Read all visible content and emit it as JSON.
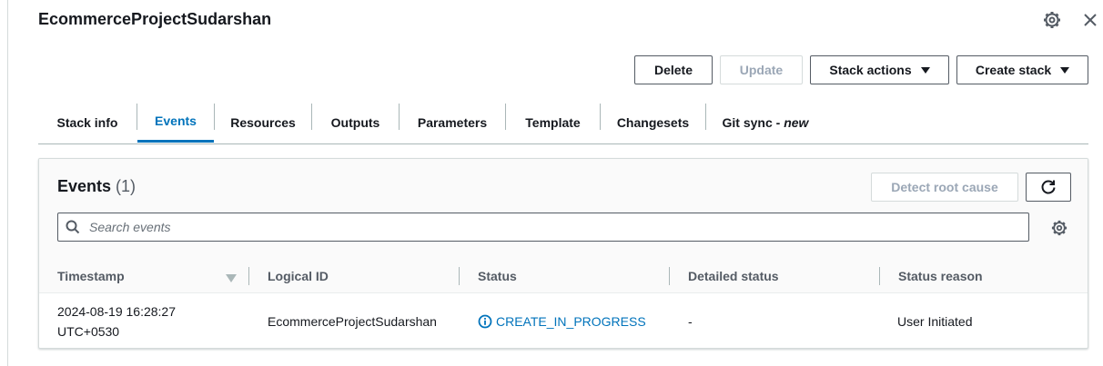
{
  "page": {
    "title": "EcommerceProjectSudarshan"
  },
  "toolbar": {
    "delete_label": "Delete",
    "update_label": "Update",
    "stack_actions_label": "Stack actions",
    "create_stack_label": "Create stack"
  },
  "tabs": [
    {
      "label": "Stack info"
    },
    {
      "label": "Events"
    },
    {
      "label": "Resources"
    },
    {
      "label": "Outputs"
    },
    {
      "label": "Parameters"
    },
    {
      "label": "Template"
    },
    {
      "label": "Changesets"
    },
    {
      "label": "Git sync - ",
      "suffix": "new"
    }
  ],
  "active_tab": "Events",
  "events": {
    "title": "Events",
    "count": "(1)",
    "detect_root_cause_label": "Detect root cause",
    "search_placeholder": "Search events",
    "columns": [
      "Timestamp",
      "Logical ID",
      "Status",
      "Detailed status",
      "Status reason"
    ],
    "rows": [
      {
        "timestamp_line1": "2024-08-19 16:28:27",
        "timestamp_line2": "UTC+0530",
        "logical_id": "EcommerceProjectSudarshan",
        "status": "CREATE_IN_PROGRESS",
        "detailed_status": "-",
        "status_reason": "User Initiated"
      }
    ]
  },
  "icons": {
    "settings": "gear-icon",
    "close": "close-icon",
    "refresh": "refresh-icon",
    "search": "search-icon",
    "sort": "sort-descending-icon",
    "status_info": "info-icon"
  },
  "colors": {
    "accent": "#0073bb",
    "text": "#16191f",
    "muted": "#545b64",
    "border": "#aab7b8"
  }
}
